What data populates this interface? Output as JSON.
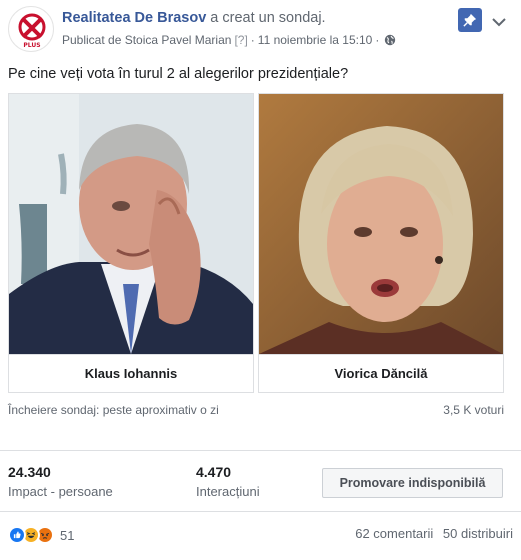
{
  "post": {
    "page_name": "Realitatea De Brasov",
    "action_text": "a creat un sondaj.",
    "published_by": "Publicat de Stoica Pavel Marian",
    "help_marker": "[?]",
    "separator": "·",
    "date": "11 noiembrie la 15:10",
    "separator2": "·",
    "avatar_text": "PLUS",
    "accent_color": "#385898"
  },
  "poll": {
    "question": "Pe cine veți vota în turul 2 al alegerilor prezidențiale?",
    "options": [
      {
        "label": "Klaus Iohannis",
        "image": "photo-klaus-iohannis"
      },
      {
        "label": "Viorica Dăncilă",
        "image": "photo-viorica-dancila"
      }
    ],
    "end_text": "Încheiere sondaj: peste aproximativ o zi",
    "votes_text": "3,5 K voturi"
  },
  "insights": {
    "reach_value": "24.340",
    "reach_label": "Impact - persoane",
    "engagement_value": "4.470",
    "engagement_label": "Interacțiuni",
    "promote_label": "Promovare indisponibilă"
  },
  "engagement": {
    "reactions": [
      "like-icon",
      "haha-icon",
      "angry-icon"
    ],
    "reaction_count": "51",
    "comments": "62 comentarii",
    "shares": "50 distribuiri"
  }
}
